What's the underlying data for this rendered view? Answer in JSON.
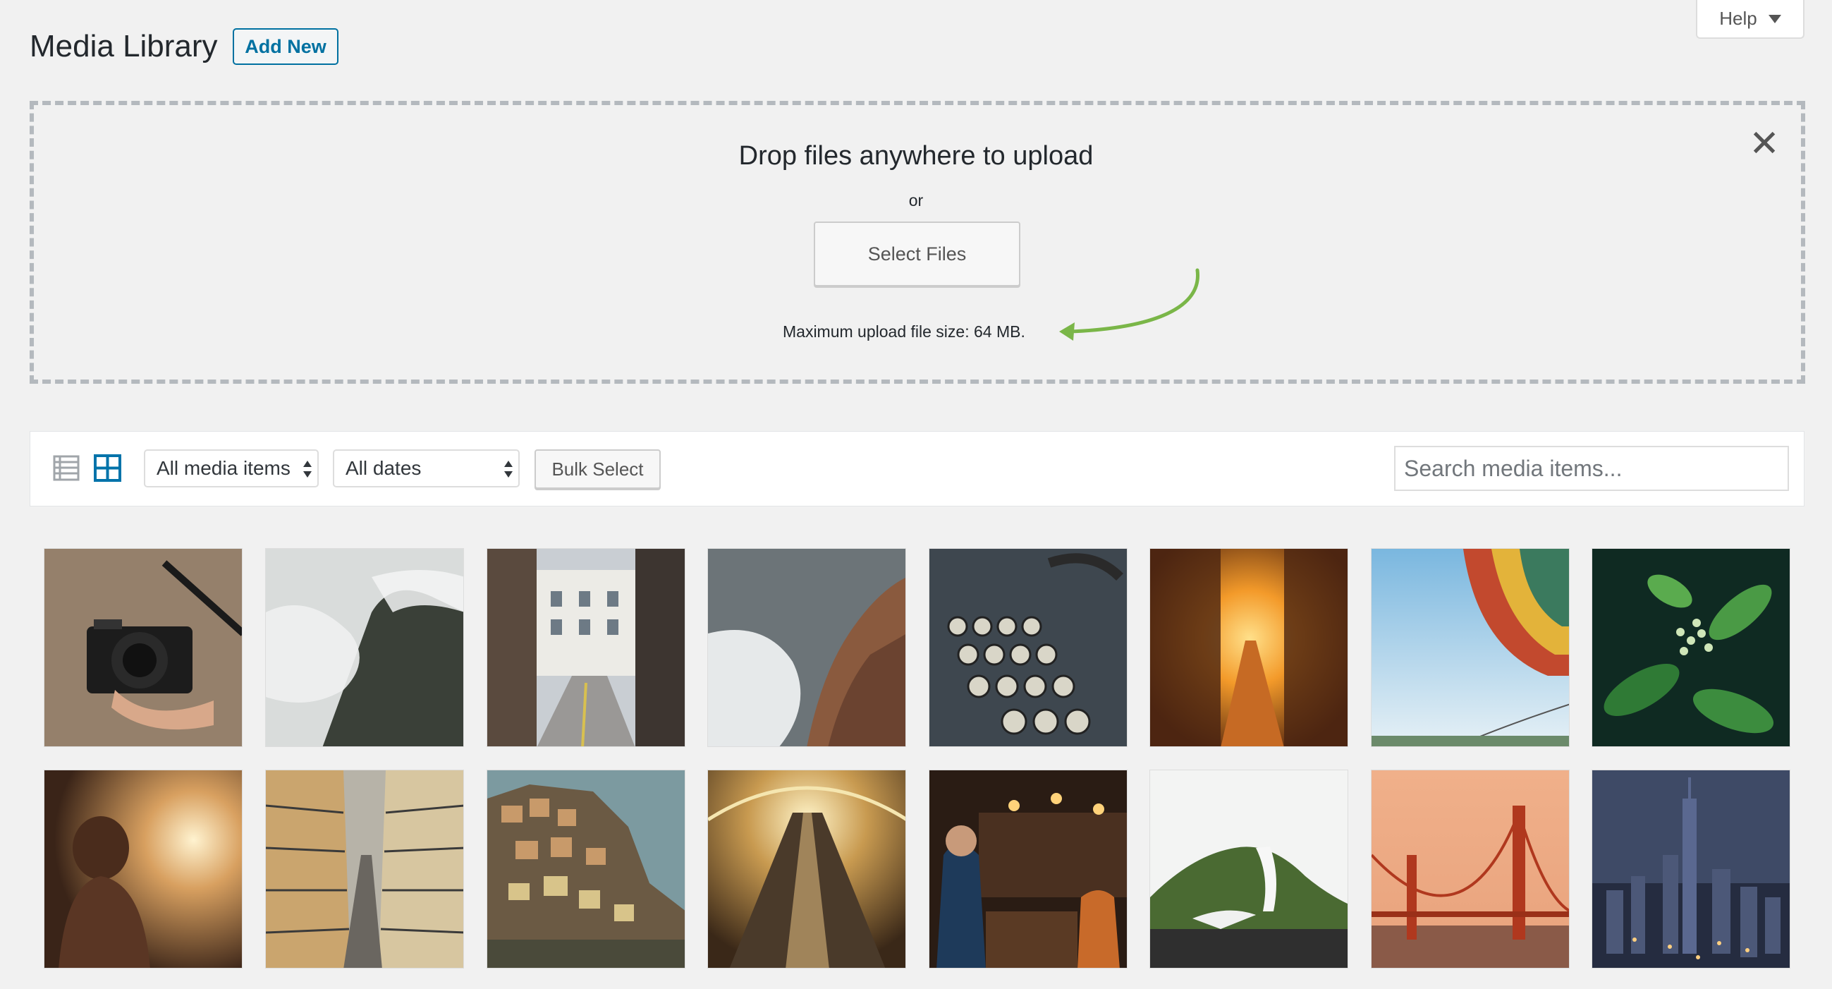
{
  "header": {
    "title": "Media Library",
    "add_new_label": "Add New",
    "help_label": "Help"
  },
  "uploader": {
    "drop_text": "Drop files anywhere to upload",
    "or_text": "or",
    "select_files_label": "Select Files",
    "max_upload_text": "Maximum upload file size: 64 MB.",
    "close_icon": "close-icon",
    "annotation_arrow_color": "#7ab648"
  },
  "toolbar": {
    "list_view_icon": "list-view-icon",
    "grid_view_icon": "grid-view-icon",
    "active_view": "grid",
    "type_filter": "All media items",
    "date_filter": "All dates",
    "bulk_select_label": "Bulk Select",
    "search_placeholder": "Search media items..."
  },
  "colors": {
    "accent": "#0071a1",
    "background": "#f1f1f1"
  },
  "media_items": [
    {
      "subject": "camera-in-hands"
    },
    {
      "subject": "misty-mountain-forest"
    },
    {
      "subject": "city-street-buildings"
    },
    {
      "subject": "waves-on-rocks"
    },
    {
      "subject": "vintage-typewriter"
    },
    {
      "subject": "sunset-alley"
    },
    {
      "subject": "hot-air-balloon"
    },
    {
      "subject": "green-plant"
    },
    {
      "subject": "woman-in-sunlight"
    },
    {
      "subject": "narrow-street-balconies"
    },
    {
      "subject": "cliffside-village"
    },
    {
      "subject": "escalator-tunnel"
    },
    {
      "subject": "busy-cafe"
    },
    {
      "subject": "green-hill-snow"
    },
    {
      "subject": "golden-gate-bridge"
    },
    {
      "subject": "city-skyline-dusk"
    }
  ]
}
